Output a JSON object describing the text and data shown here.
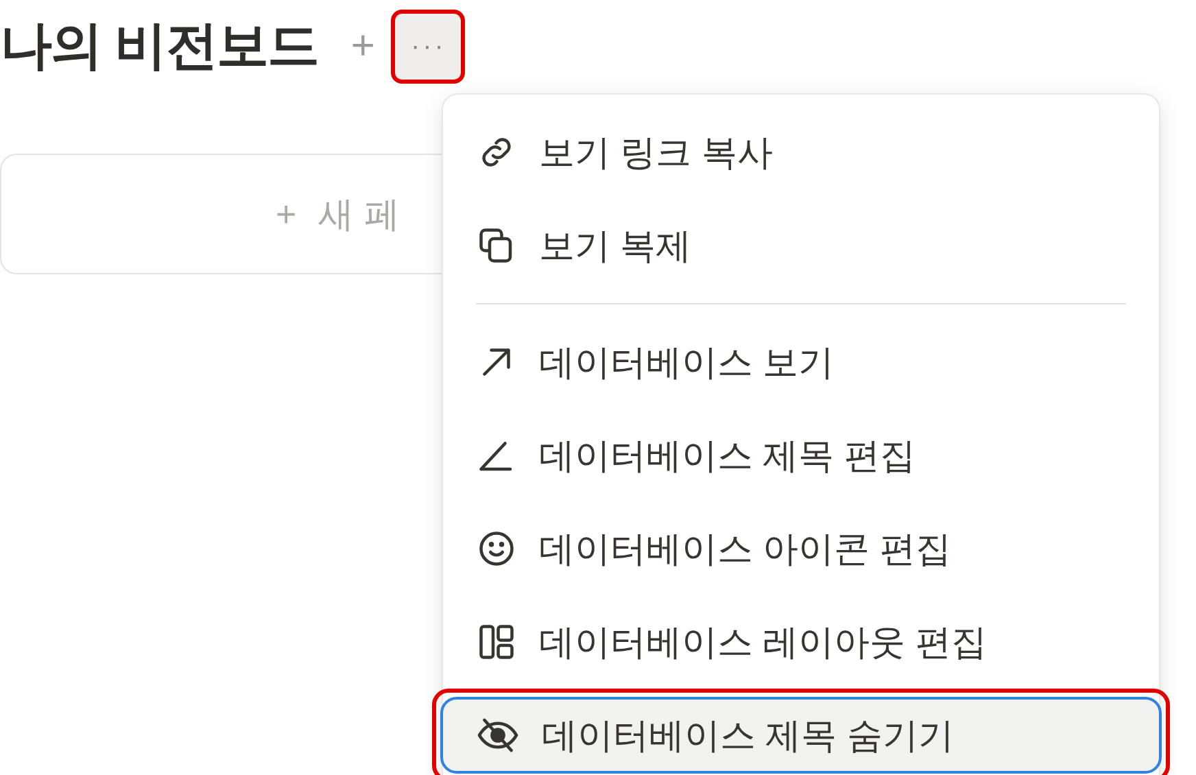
{
  "title": "나의 비전보드",
  "add_button": "+",
  "more_button": {
    "label": "···",
    "highlighted": true
  },
  "new_page_card": {
    "icon": "+",
    "label": "새 페"
  },
  "menu": {
    "groups": [
      [
        {
          "label": "보기 링크 복사",
          "selected": false,
          "highlighted": false
        },
        {
          "label": "보기 복제",
          "selected": false,
          "highlighted": false
        }
      ],
      [
        {
          "label": "데이터베이스 보기",
          "selected": false,
          "highlighted": false
        },
        {
          "label": "데이터베이스 제목 편집",
          "selected": false,
          "highlighted": false
        },
        {
          "label": "데이터베이스 아이콘 편집",
          "selected": false,
          "highlighted": false
        },
        {
          "label": "데이터베이스 레이아웃 편집",
          "selected": false,
          "highlighted": false
        },
        {
          "label": "데이터베이스 제목 숨기기",
          "selected": true,
          "highlighted": true
        }
      ]
    ]
  }
}
